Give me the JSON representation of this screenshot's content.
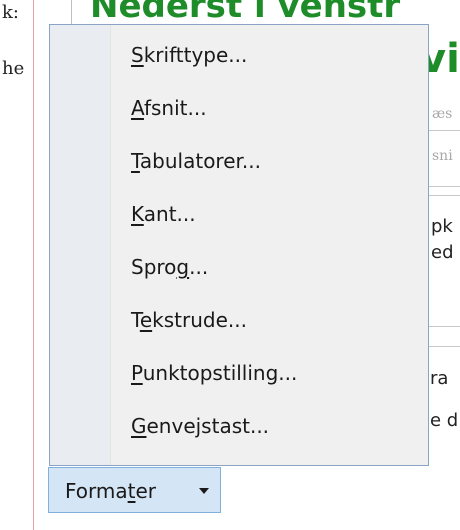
{
  "background": {
    "left_labels": [
      "k:",
      "he"
    ],
    "heading_line1": "Nederst i venstr",
    "heading_line2": "vi",
    "faint_lines": [
      "æs",
      "sni"
    ],
    "box_lines": [
      "pk",
      "ed"
    ],
    "right_lines": [
      "ra",
      "e d"
    ]
  },
  "menu": {
    "items": [
      {
        "pre": "",
        "key": "S",
        "post": "krifttype..."
      },
      {
        "pre": "",
        "key": "A",
        "post": "fsnit..."
      },
      {
        "pre": "",
        "key": "T",
        "post": "abulatorer..."
      },
      {
        "pre": "",
        "key": "K",
        "post": "ant..."
      },
      {
        "pre": "Spro",
        "key": "g",
        "post": "..."
      },
      {
        "pre": "T",
        "key": "e",
        "post": "kstrude..."
      },
      {
        "pre": "",
        "key": "P",
        "post": "unktopstilling..."
      },
      {
        "pre": "",
        "key": "G",
        "post": "envejstast..."
      }
    ]
  },
  "button": {
    "pre": "Forma",
    "key": "t",
    "post": "er",
    "icon": "chevron-down-icon"
  }
}
